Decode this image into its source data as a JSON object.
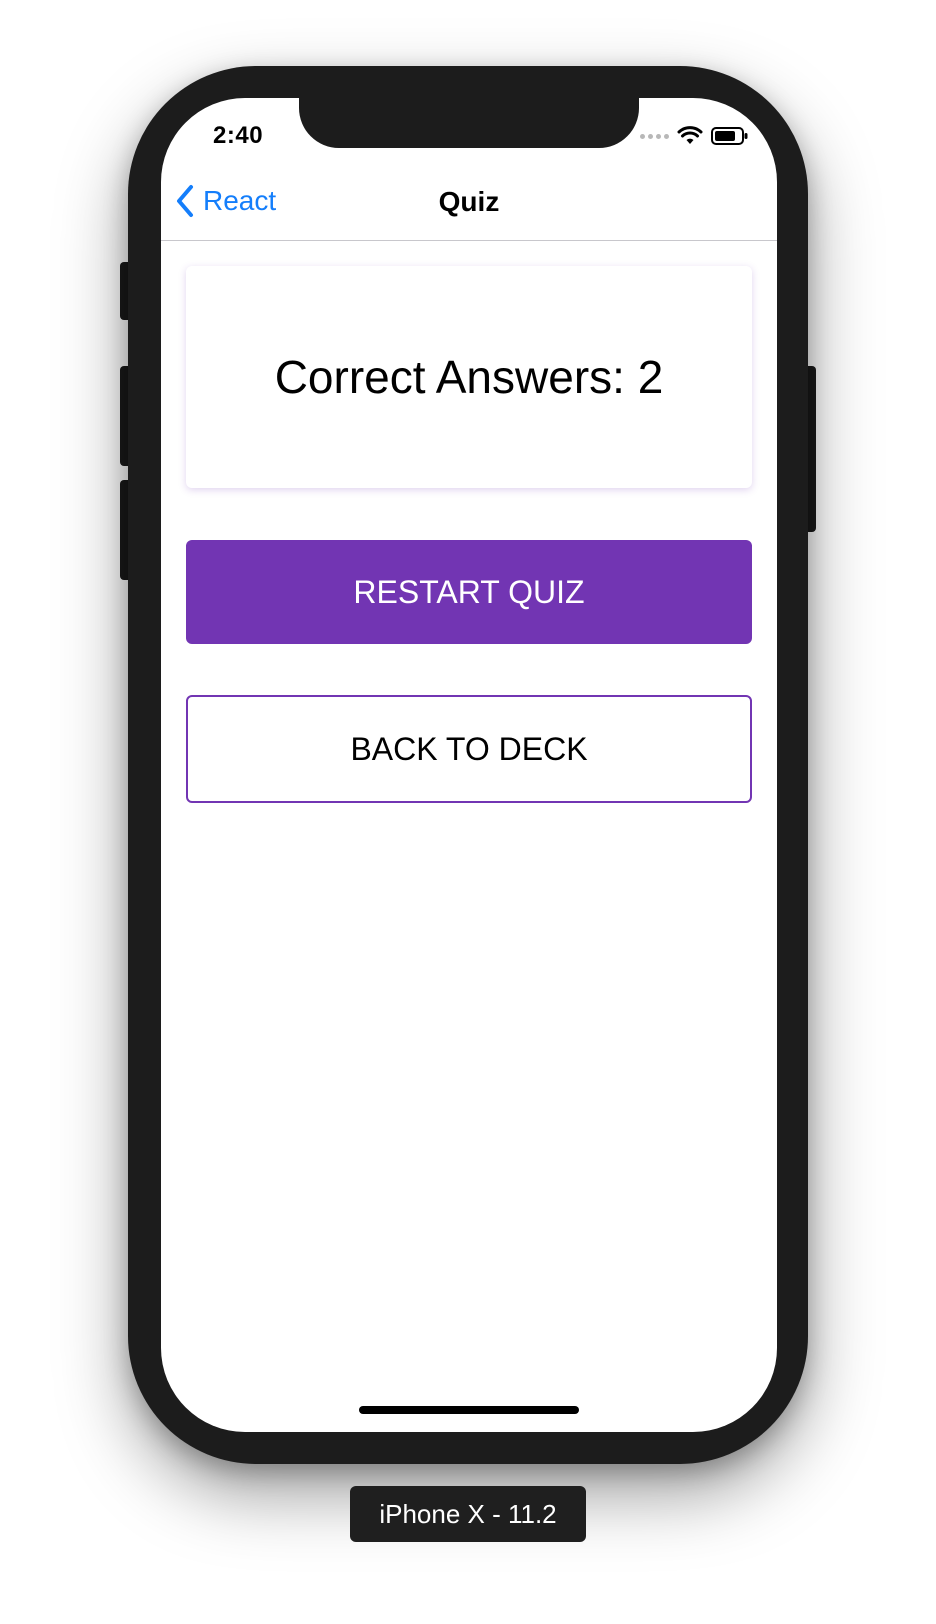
{
  "status_bar": {
    "time": "2:40"
  },
  "nav": {
    "back_label": "React",
    "title": "Quiz"
  },
  "result": {
    "text": "Correct Answers: 2"
  },
  "buttons": {
    "restart": "RESTART QUIZ",
    "back_to_deck": "BACK TO DECK"
  },
  "device": {
    "label": "iPhone X - 11.2"
  },
  "colors": {
    "accent": "#7235b3",
    "link": "#147efb"
  }
}
